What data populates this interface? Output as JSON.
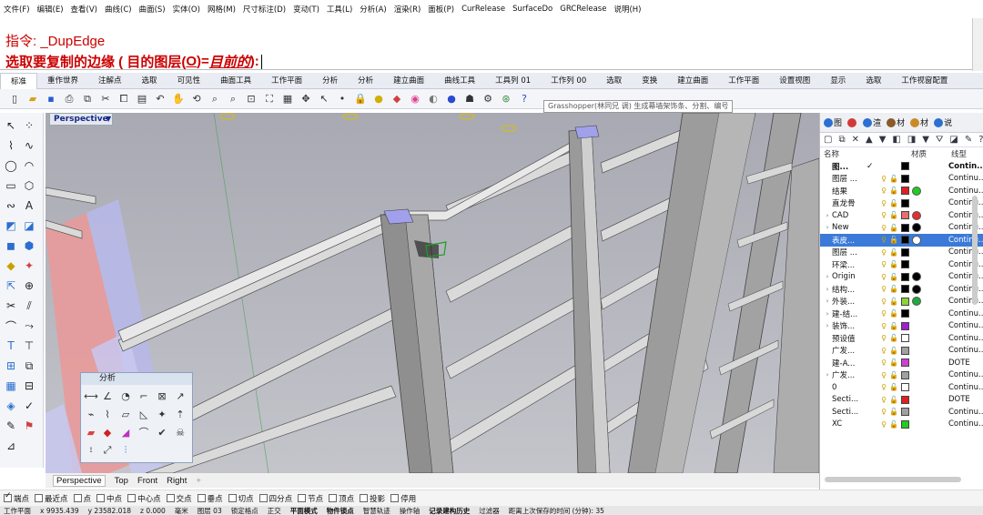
{
  "menu": {
    "items": [
      "文件(F)",
      "编辑(E)",
      "查看(V)",
      "曲线(C)",
      "曲面(S)",
      "实体(O)",
      "网格(M)",
      "尺寸标注(D)",
      "变动(T)",
      "工具(L)",
      "分析(A)",
      "渲染(R)",
      "面板(P)",
      "CurRelease",
      "SurfaceDo",
      "GRCRelease",
      "说明(H)"
    ]
  },
  "command": {
    "prompt_label": "指令: _DupEdge",
    "select_prefix": "选取要复制的边缘 ( 目的图层(",
    "option_key": "O",
    "option_rest": ")=",
    "option_value": "目前的",
    "select_suffix": " ):"
  },
  "toolbar_tabs": {
    "items": [
      "标准",
      "重作世界",
      "注解点",
      "选取",
      "可见性",
      "曲面工具",
      "工作平面",
      "分析",
      "分析",
      "建立曲面",
      "曲线工具",
      "工具列 01",
      "工作列 00",
      "选取",
      "变换",
      "建立曲面",
      "工作平面",
      "设置视图",
      "显示",
      "选取",
      "工作视窗配置"
    ],
    "active_index": 0
  },
  "tooltip": "Grasshopper(林同兄 调) 生成幕墙架饰条、分割、编号",
  "viewport": {
    "label": "Perspective"
  },
  "palette": {
    "title": "分析"
  },
  "view_tabs": {
    "items": [
      "Perspective",
      "Top",
      "Front",
      "Right"
    ],
    "active_index": 0
  },
  "osnap": {
    "items": [
      {
        "label": "端点",
        "checked": true
      },
      {
        "label": "最近点",
        "checked": false
      },
      {
        "label": "点",
        "checked": false
      },
      {
        "label": "中点",
        "checked": false
      },
      {
        "label": "中心点",
        "checked": false
      },
      {
        "label": "交点",
        "checked": false
      },
      {
        "label": "垂点",
        "checked": false
      },
      {
        "label": "切点",
        "checked": false
      },
      {
        "label": "四分点",
        "checked": false
      },
      {
        "label": "节点",
        "checked": false
      },
      {
        "label": "顶点",
        "checked": false
      },
      {
        "label": "投影",
        "checked": false
      },
      {
        "label": "停用",
        "checked": false
      }
    ]
  },
  "status": {
    "cplane": "工作平面",
    "x": "x 9935.439",
    "y": "y 23582.018",
    "z": "z 0.000",
    "unit": "毫米",
    "layer": "图层 03",
    "items": [
      "锁定格点",
      "正交",
      "平面模式",
      "物件锁点",
      "智慧轨迹",
      "操作轴",
      "记录建构历史",
      "过滤器",
      "距离上次保存的时间 (分钟): 35"
    ]
  },
  "panel": {
    "tabs": [
      {
        "label": "图",
        "color": "#2a6fd1"
      },
      {
        "label": "",
        "color": "#d23a3a"
      },
      {
        "label": "渲",
        "color": "#2a6fd1"
      },
      {
        "label": "材",
        "color": "#8a5a2a"
      },
      {
        "label": "材",
        "color": "#c98a2a"
      },
      {
        "label": "说",
        "color": "#2a6fd1"
      }
    ],
    "tools": [
      "▢",
      "⧉",
      "✕",
      "▲",
      "▼",
      "◧",
      "◨",
      "▼",
      "⛛",
      "◪",
      "✎",
      "?"
    ],
    "col_name": "名称",
    "col_material": "材质",
    "col_linetype": "线型",
    "layers": [
      {
        "name": "图...",
        "current": true,
        "expand": "",
        "swatch": "#000000",
        "mat": "",
        "linetype": "Contin...",
        "bold": true,
        "selected": false
      },
      {
        "name": "图层 ...",
        "current": false,
        "expand": "",
        "swatch": "#000000",
        "mat": "",
        "linetype": "Continu...",
        "bold": false,
        "selected": false
      },
      {
        "name": "结果",
        "current": false,
        "expand": "",
        "swatch": "#e02020",
        "mat": "#20cc20",
        "linetype": "Continu...",
        "bold": false,
        "selected": false
      },
      {
        "name": "直龙骨",
        "current": false,
        "expand": "",
        "swatch": "#000000",
        "mat": "",
        "linetype": "Continu...",
        "bold": false,
        "selected": false
      },
      {
        "name": "CAD",
        "current": false,
        "expand": "›",
        "swatch": "#e57070",
        "mat": "#e03030",
        "linetype": "Continu...",
        "bold": false,
        "selected": false
      },
      {
        "name": "New",
        "current": false,
        "expand": "›",
        "swatch": "#000000",
        "mat": "#000000",
        "linetype": "Continu...",
        "bold": false,
        "selected": false
      },
      {
        "name": "表皮...",
        "current": false,
        "expand": "",
        "swatch": "#000000",
        "mat": "#ffffff",
        "linetype": "Continu...",
        "bold": false,
        "selected": true
      },
      {
        "name": "图层 ...",
        "current": false,
        "expand": "",
        "swatch": "#000000",
        "mat": "",
        "linetype": "Continu...",
        "bold": false,
        "selected": false
      },
      {
        "name": "环梁...",
        "current": false,
        "expand": "",
        "swatch": "#000000",
        "mat": "",
        "linetype": "Continu...",
        "bold": false,
        "selected": false
      },
      {
        "name": "Origin",
        "current": false,
        "expand": "›",
        "swatch": "#000000",
        "mat": "#000000",
        "linetype": "Continu...",
        "bold": false,
        "selected": false
      },
      {
        "name": "结构...",
        "current": false,
        "expand": "›",
        "swatch": "#000000",
        "mat": "#000000",
        "linetype": "Continu...",
        "bold": false,
        "selected": false
      },
      {
        "name": "外装...",
        "current": false,
        "expand": "›",
        "swatch": "#8ad43a",
        "mat": "#20aa40",
        "linetype": "Continu...",
        "bold": false,
        "selected": false
      },
      {
        "name": "建-结...",
        "current": false,
        "expand": "›",
        "swatch": "#000000",
        "mat": "",
        "linetype": "Continu...",
        "bold": false,
        "selected": false
      },
      {
        "name": "装饰...",
        "current": false,
        "expand": "›",
        "swatch": "#a020d0",
        "mat": "",
        "linetype": "Continu...",
        "bold": false,
        "selected": false
      },
      {
        "name": "预设值",
        "current": false,
        "expand": "",
        "swatch": "#ffffff",
        "mat": "",
        "linetype": "Continu...",
        "bold": false,
        "selected": false
      },
      {
        "name": "广发...",
        "current": false,
        "expand": "",
        "swatch": "#a0a0a0",
        "mat": "",
        "linetype": "Continu...",
        "bold": false,
        "selected": false
      },
      {
        "name": "建-A...",
        "current": false,
        "expand": "",
        "swatch": "#d040d0",
        "mat": "",
        "linetype": "DOTE",
        "bold": false,
        "selected": false
      },
      {
        "name": "广发...",
        "current": false,
        "expand": "›",
        "swatch": "#a0a0a0",
        "mat": "",
        "linetype": "Continu...",
        "bold": false,
        "selected": false
      },
      {
        "name": "0",
        "current": false,
        "expand": "",
        "swatch": "#ffffff",
        "mat": "",
        "linetype": "Continu...",
        "bold": false,
        "selected": false
      },
      {
        "name": "Secti...",
        "current": false,
        "expand": "",
        "swatch": "#e02020",
        "mat": "",
        "linetype": "DOTE",
        "bold": false,
        "selected": false
      },
      {
        "name": "Secti...",
        "current": false,
        "expand": "",
        "swatch": "#a0a0a0",
        "mat": "",
        "linetype": "Continu...",
        "bold": false,
        "selected": false
      },
      {
        "name": "XC",
        "current": false,
        "expand": "",
        "swatch": "#20cc20",
        "mat": "",
        "linetype": "Continu...",
        "bold": false,
        "selected": false
      }
    ]
  }
}
